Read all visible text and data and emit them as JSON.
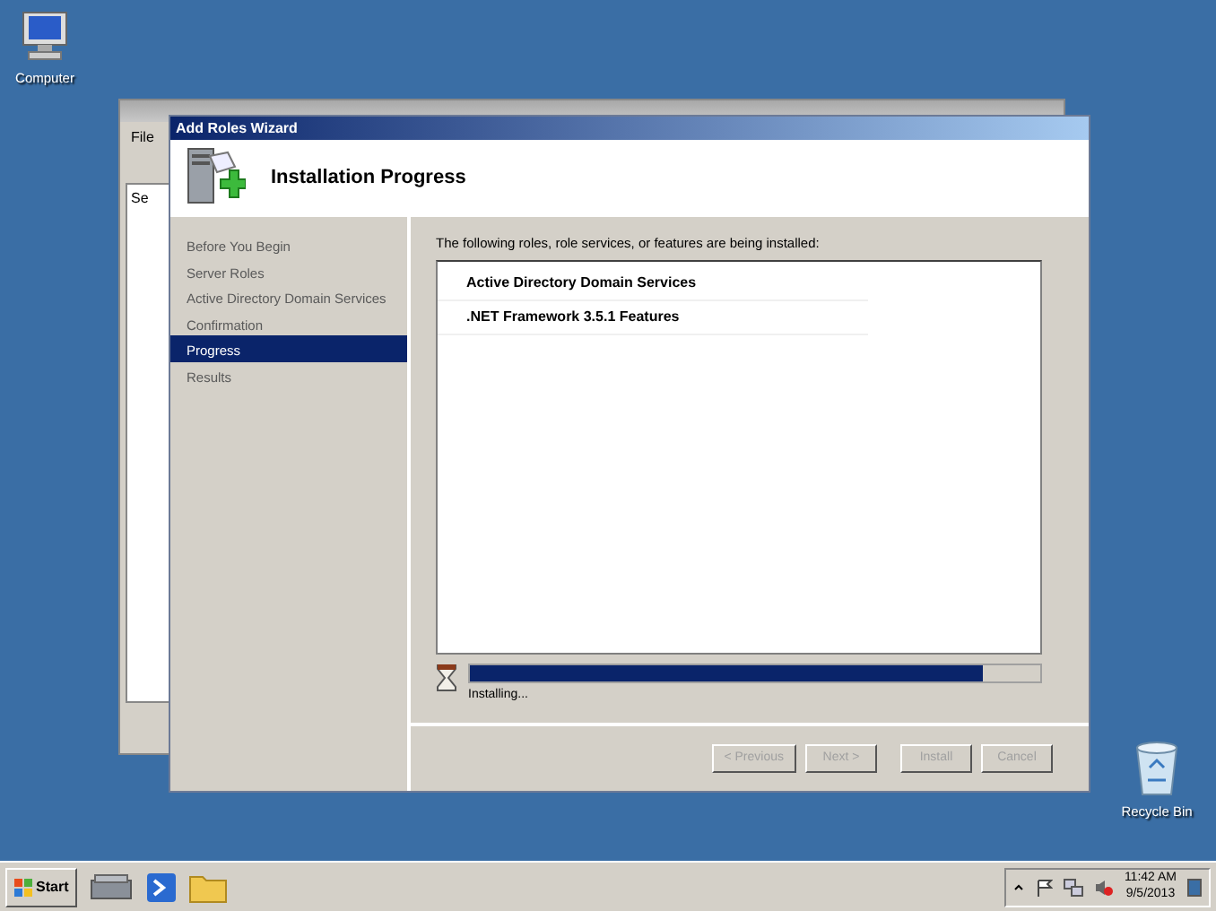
{
  "desktop_icons": [
    {
      "kind": "computer",
      "label": "Computer"
    },
    {
      "kind": "recycle",
      "label": "Recycle Bin"
    }
  ],
  "background_window": {
    "menu": [
      "File"
    ],
    "tree_item": "Se"
  },
  "wizard": {
    "title": "Add Roles Wizard",
    "heading": "Installation Progress",
    "steps": [
      {
        "label": "Before You Begin",
        "selected": false
      },
      {
        "label": "Server Roles",
        "selected": false
      },
      {
        "label": "Active Directory Domain Services",
        "selected": false
      },
      {
        "label": "Confirmation",
        "selected": false
      },
      {
        "label": "Progress",
        "selected": true
      },
      {
        "label": "Results",
        "selected": false
      }
    ],
    "intro": "The following roles, role services, or features are being installed:",
    "items": [
      "Active Directory Domain Services",
      ".NET Framework 3.5.1 Features"
    ],
    "progress": {
      "level": 0.9,
      "status": "Installing..."
    },
    "buttons": [
      {
        "label": "< Previous",
        "disabled": true
      },
      {
        "label": "Next >",
        "disabled": true
      },
      {
        "label": "Install",
        "disabled": true
      },
      {
        "label": "Cancel",
        "disabled": true
      }
    ]
  },
  "taskbar": {
    "start": "Start",
    "time": "11:42 AM",
    "date": "9/5/2013"
  }
}
